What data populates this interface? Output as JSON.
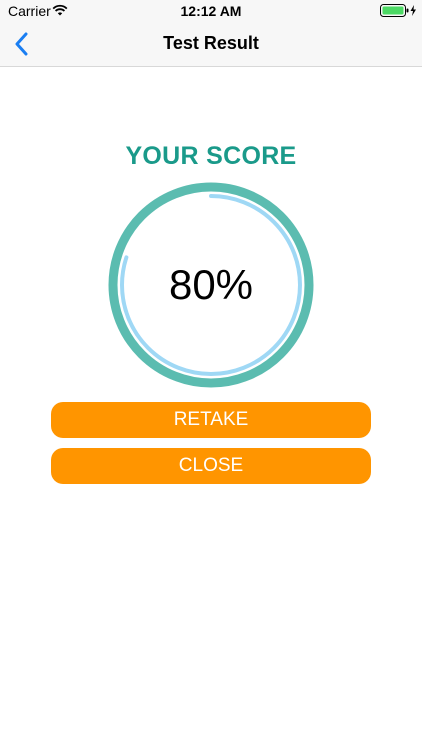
{
  "status_bar": {
    "carrier": "Carrier",
    "time": "12:12 AM",
    "wifi_icon": "wifi-icon",
    "battery_icon": "battery-charging-icon"
  },
  "nav": {
    "title": "Test Result",
    "back_icon": "chevron-left-icon"
  },
  "score": {
    "heading": "YOUR SCORE",
    "value_text": "80%",
    "progress_fraction": 0.8
  },
  "buttons": {
    "retake_label": "RETAKE",
    "close_label": "CLOSE"
  },
  "colors": {
    "accent_teal": "#1a9a8a",
    "ring_outer": "#5bbcb0",
    "ring_progress": "#9fd8f5",
    "button_orange": "#ff9500",
    "back_blue": "#1a7ef2",
    "battery_green": "#4cd964"
  }
}
